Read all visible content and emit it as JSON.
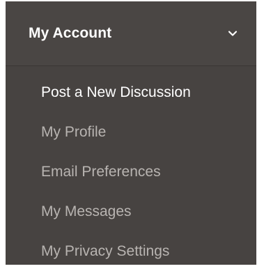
{
  "menu": {
    "title": "My Account",
    "toggle_icon": "chevron-down-icon",
    "items": [
      {
        "label": "Post a New Discussion",
        "active": true
      },
      {
        "label": "My Profile",
        "active": false
      },
      {
        "label": "Email Preferences",
        "active": false
      },
      {
        "label": "My Messages",
        "active": false
      },
      {
        "label": "My Privacy Settings",
        "active": false
      }
    ]
  },
  "colors": {
    "panel_background": "#474341",
    "header_background": "#4a4644",
    "active_text": "#ffffff",
    "inactive_text": "#b8b4b1"
  }
}
